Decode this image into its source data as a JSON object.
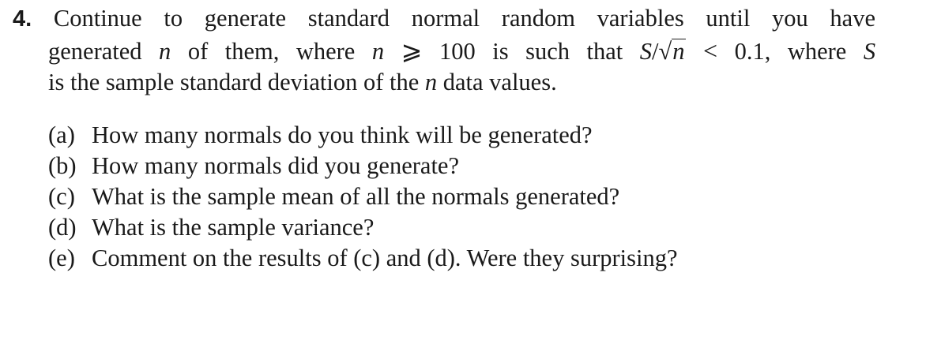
{
  "problem": {
    "number": "4.",
    "intro": {
      "line1": "Continue to generate standard normal random variables until you have",
      "line2_a": "generated",
      "line2_n1": "n",
      "line2_b": "of them, where",
      "line2_n2": "n",
      "line2_geq": "⩾",
      "line2_c": "100 is such that",
      "line2_S": "S",
      "line2_slash": "/",
      "line2_sqrt_arg": "n",
      "line2_lt": "<",
      "line2_d": "0.1, where",
      "line2_S2": "S",
      "line3_a": "is the sample standard deviation of the",
      "line3_n": "n",
      "line3_b": "data values."
    },
    "parts": [
      {
        "label": "(a)",
        "text": "How many normals do you think will be generated?"
      },
      {
        "label": "(b)",
        "text": "How many normals did you generate?"
      },
      {
        "label": "(c)",
        "text": "What is the sample mean of all the normals generated?"
      },
      {
        "label": "(d)",
        "text": "What is the sample variance?"
      },
      {
        "label": "(e)",
        "text": "Comment on the results of (c) and (d). Were they surprising?"
      }
    ]
  }
}
